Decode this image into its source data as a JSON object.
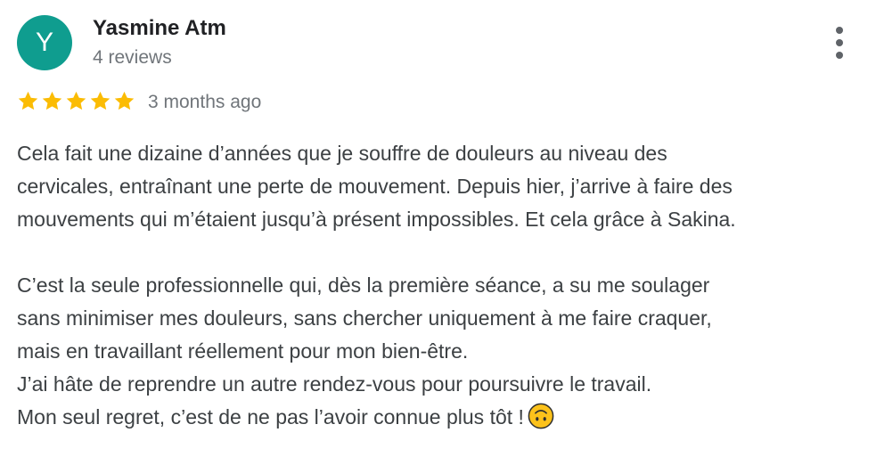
{
  "review": {
    "author": {
      "initial": "Y",
      "name": "Yasmine Atm",
      "review_count": "4 reviews",
      "avatar_color": "#0f9d8f"
    },
    "menu_icon": "more-vert-icon",
    "rating": {
      "stars": 5,
      "max": 5,
      "star_color": "#fbbc04"
    },
    "date": "3 months ago",
    "text_lines": [
      "Cela fait une dizaine d’années que je souffre de douleurs au niveau des",
      "cervicales, entraînant une perte de mouvement. Depuis hier, j’arrive à faire des",
      "mouvements qui m’étaient jusqu’à présent impossibles. Et cela grâce à Sakina.",
      "",
      "C’est la seule professionnelle qui, dès la première séance, a su me soulager",
      "sans minimiser mes douleurs, sans chercher uniquement à me faire craquer,",
      "mais en travaillant réellement pour mon bien-être.",
      "J’ai hâte de reprendre un autre rendez-vous pour poursuivre le travail.",
      "Mon seul regret, c’est de ne pas l’avoir connue plus tôt !"
    ],
    "end_emoji": "upside-down-face-emoji"
  }
}
